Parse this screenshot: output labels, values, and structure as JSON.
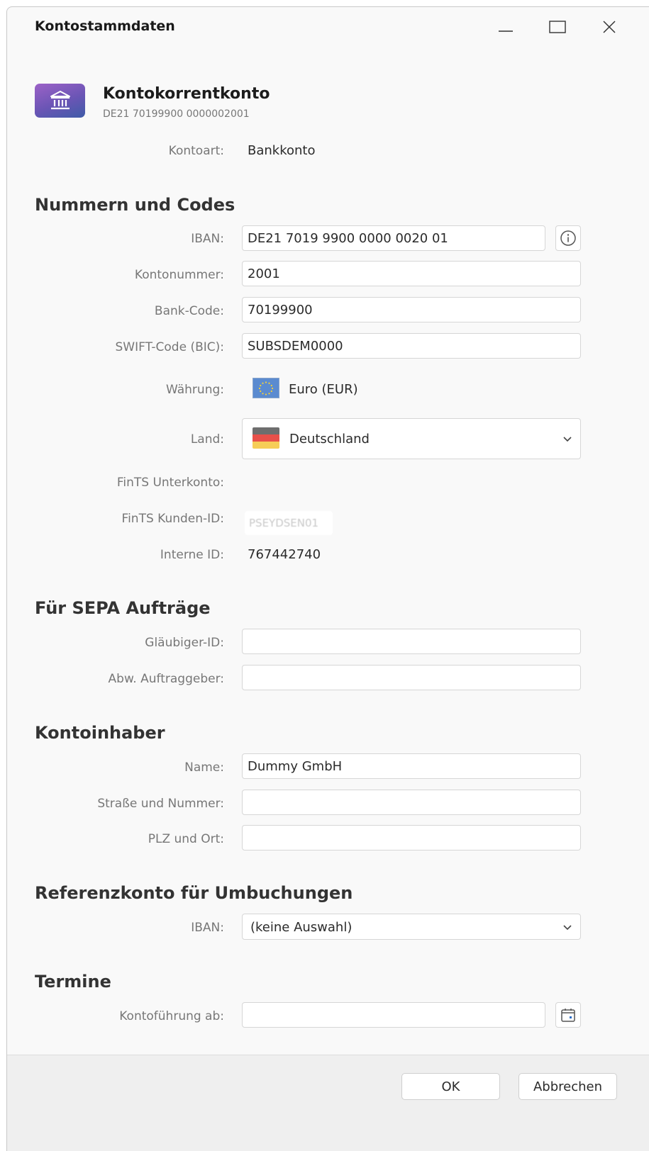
{
  "window": {
    "title": "Kontostammdaten"
  },
  "account": {
    "icon": "bank-icon",
    "name": "Kontokorrentkonto",
    "iban_display": "DE21 70199900 0000002001",
    "type_label": "Kontoart:",
    "type_value": "Bankkonto",
    "accent_colors": [
      "#9c62c7",
      "#3f5ca8"
    ]
  },
  "numbers": {
    "heading": "Nummern und Codes",
    "iban_label": "IBAN:",
    "iban_value": "DE21 7019 9900 0000 0020 01",
    "account_no_label": "Kontonummer:",
    "account_no_value": "2001",
    "bank_code_label": "Bank-Code:",
    "bank_code_value": "70199900",
    "swift_label": "SWIFT-Code (BIC):",
    "swift_value": "SUBSDEM0000",
    "currency_label": "Währung:",
    "currency_value": "Euro (EUR)",
    "country_label": "Land:",
    "country_value": "Deutschland",
    "fints_subaccount_label": "FinTS Unterkonto:",
    "fints_customer_label": "FinTS Kunden-ID:",
    "fints_customer_value": "PSEYDSEN01",
    "internal_id_label": "Interne ID:",
    "internal_id_value": "767442740"
  },
  "sepa": {
    "heading": "Für SEPA Aufträge",
    "creditor_label": "Gläubiger-ID:",
    "creditor_value": "",
    "originator_label": "Abw. Auftraggeber:",
    "originator_value": ""
  },
  "holder": {
    "heading": "Kontoinhaber",
    "name_label": "Name:",
    "name_value": "Dummy GmbH",
    "street_label": "Straße und Nummer:",
    "street_value": "",
    "city_label": "PLZ und Ort:",
    "city_value": ""
  },
  "reference": {
    "heading": "Referenzkonto für Umbuchungen",
    "iban_label": "IBAN:",
    "iban_value": "(keine Auswahl)"
  },
  "dates": {
    "heading": "Termine",
    "start_label": "Kontoführung ab:",
    "start_value": ""
  },
  "footer": {
    "ok_label": "OK",
    "cancel_label": "Abbrechen"
  }
}
